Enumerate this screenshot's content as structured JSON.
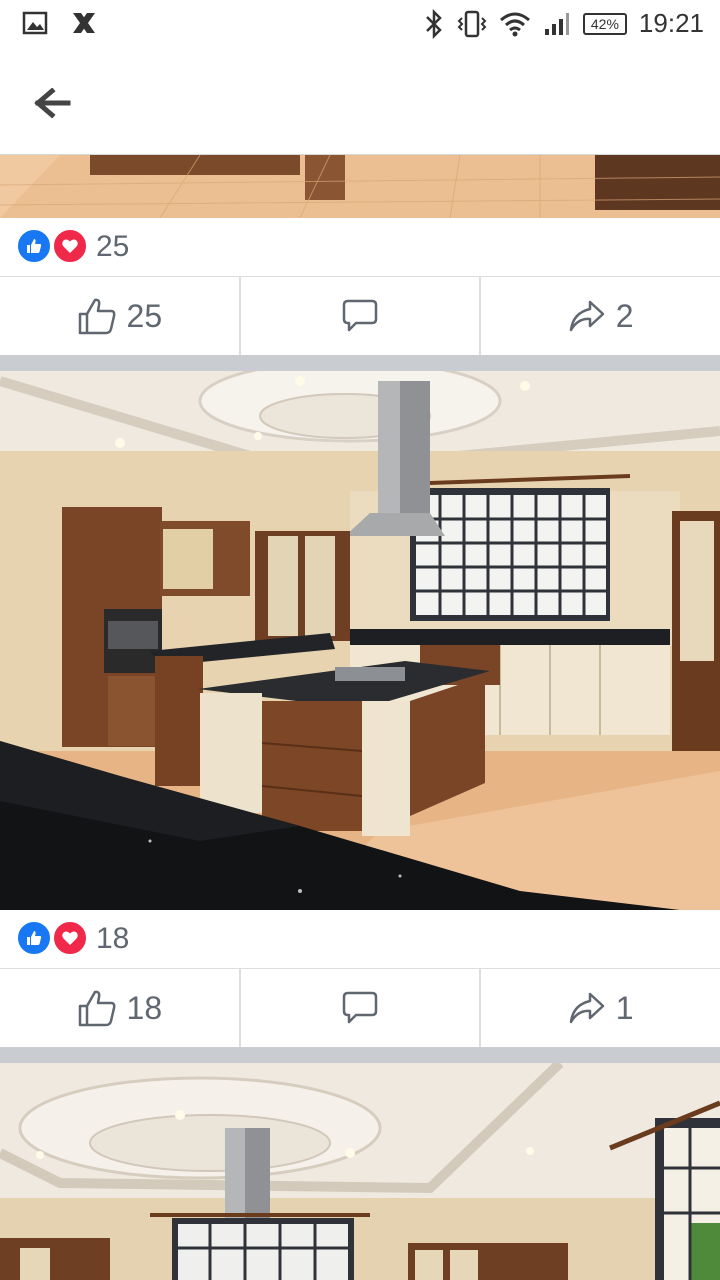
{
  "status_bar": {
    "battery": "42%",
    "time": "19:21"
  },
  "posts": [
    {
      "reaction_count": "25",
      "like_count": "25",
      "share_count": "2"
    },
    {
      "reaction_count": "18",
      "like_count": "18",
      "share_count": "1"
    }
  ],
  "icons": [
    "image-icon",
    "x-app-icon",
    "bluetooth-icon",
    "vibrate-icon",
    "wifi-icon",
    "signal-icon",
    "back-arrow-icon",
    "like-reaction-icon",
    "love-reaction-icon",
    "thumbs-up-icon",
    "comment-icon",
    "share-icon"
  ],
  "colors": {
    "like_blue": "#1877f2",
    "love_red": "#f0284a",
    "text_gray": "#606770",
    "divider": "#c9ccd1"
  }
}
